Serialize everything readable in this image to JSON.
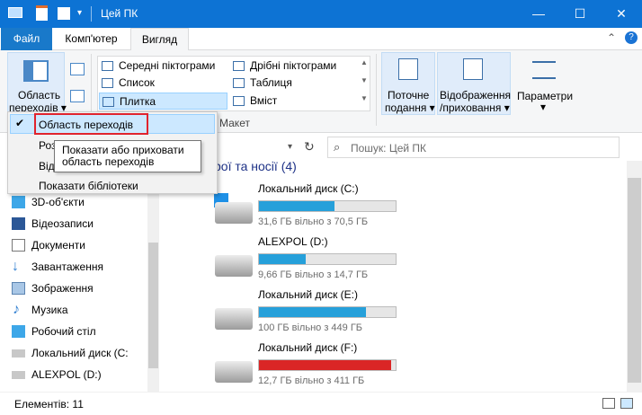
{
  "window": {
    "title": "Цей ПК",
    "minimize": "—",
    "maximize": "☐",
    "close": "✕"
  },
  "tabs": {
    "file": "Файл",
    "computer": "Комп'ютер",
    "view": "Вигляд"
  },
  "ribbon": {
    "nav_pane": {
      "label_line1": "Область",
      "label_line2": "переходів ▾"
    },
    "layout": {
      "col1": [
        "Середні піктограми",
        "Список",
        "Плитка"
      ],
      "col2": [
        "Дрібні піктограми",
        "Таблиця",
        "Вміст"
      ],
      "group_label": "Макет"
    },
    "current_view": {
      "line1": "Поточне",
      "line2": "подання ▾"
    },
    "show_hide": {
      "line1": "Відображення",
      "line2": "/приховання ▾"
    },
    "options": {
      "line1": "Параметри",
      "line2": "▾"
    }
  },
  "dropdown": {
    "items": [
      "Область переходів",
      "Розпо",
      "Відоб",
      "Показати бібліотеки"
    ],
    "checkmark": "✔"
  },
  "tooltip": {
    "line1": "Показати або приховати",
    "line2": "область переходів"
  },
  "search": {
    "placeholder": "Пошук: Цей ПК"
  },
  "section_header": "рої та носії (4)",
  "sidebar": {
    "items": [
      "3D-об'єкти",
      "Відеозаписи",
      "Документи",
      "Завантаження",
      "Зображення",
      "Музика",
      "Робочий стіл",
      "Локальний диск (C:",
      "ALEXPOL (D:)"
    ]
  },
  "drives": [
    {
      "name": "Локальний диск (C:)",
      "free": "31,6 ГБ вільно з 70,5 ГБ",
      "used_fraction": 0.55,
      "color": "#26a0da"
    },
    {
      "name": "ALEXPOL (D:)",
      "free": "9,66 ГБ вільно з 14,7 ГБ",
      "used_fraction": 0.34,
      "color": "#26a0da"
    },
    {
      "name": "Локальний диск (E:)",
      "free": "100 ГБ вільно з 449 ГБ",
      "used_fraction": 0.78,
      "color": "#26a0da"
    },
    {
      "name": "Локальний диск (F:)",
      "free": "12,7 ГБ вільно з 411 ГБ",
      "used_fraction": 0.97,
      "color": "#da2626"
    }
  ],
  "status": {
    "items_count": "Елементів: 11"
  },
  "colors": {
    "accent": "#0d73d4",
    "highlight_box": "#e0232d"
  }
}
